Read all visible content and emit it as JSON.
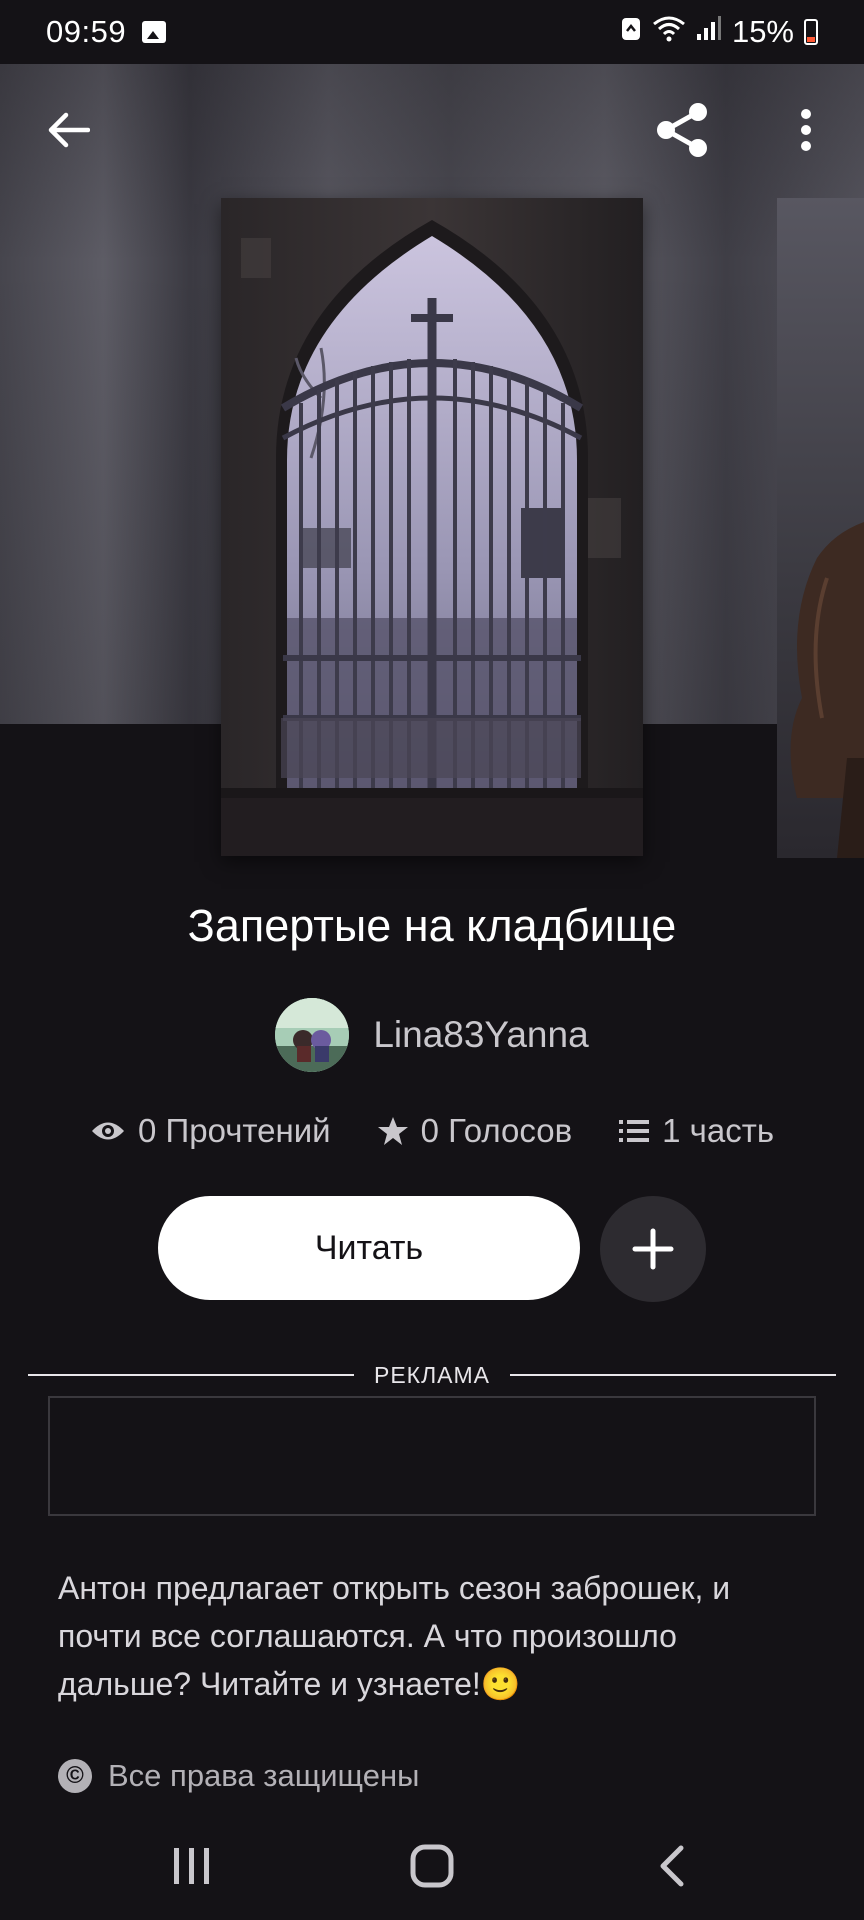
{
  "status_bar": {
    "time": "09:59",
    "battery": "15%",
    "battery_level": 0.15
  },
  "toolbar": {
    "back_icon": "arrow-left-icon",
    "share_icon": "share-icon",
    "more_icon": "more-vertical-icon"
  },
  "story": {
    "title": "Запертые на кладбище",
    "author": "Lina83Yanna",
    "stats": {
      "reads": "0 Прочтений",
      "votes": "0 Голосов",
      "parts": "1 часть"
    },
    "read_label": "Читать",
    "description": "Антон предлагает открыть сезон заброшек, и почти все соглашаются. А что произошло дальше? Читайте и узнаете!🙂",
    "copyright": "Все права защищены"
  },
  "ad": {
    "label": "РЕКЛАМА"
  },
  "colors": {
    "background": "#141216",
    "button_white": "#ffffff",
    "add_button": "#2d2b30",
    "battery_low": "#ff5a36"
  }
}
